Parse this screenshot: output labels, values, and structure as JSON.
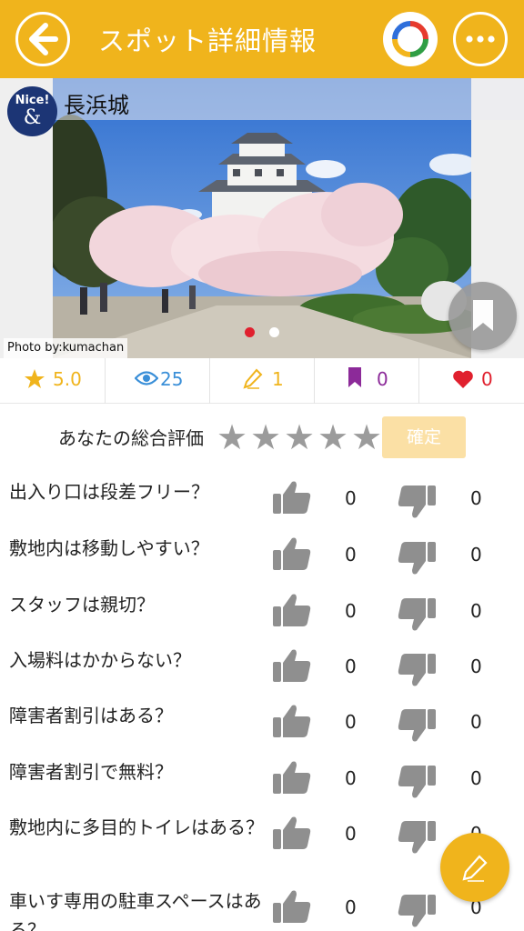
{
  "header": {
    "title": "スポット詳細情報",
    "back_icon": "arrow-left-icon",
    "ring_icon": "multicolor-ring-icon",
    "more_icon": "ellipsis-icon",
    "color": "#f0b41c"
  },
  "spot": {
    "name": "長浜城",
    "badge_text": "Nice!",
    "badge_symbol": "&",
    "photo_credit": "Photo by:kumachan",
    "carousel_active_index": 0,
    "carousel_count": 2
  },
  "stats": {
    "rating": "5.0",
    "views": "25",
    "reviews": "1",
    "bookmarks": "0",
    "likes": "0"
  },
  "rating": {
    "label": "あなたの総合評価",
    "stars_selected": 0,
    "stars_total": 5,
    "confirm_label": "確定"
  },
  "questions": [
    {
      "text": "出入り口は段差フリー？",
      "yes": "0",
      "no": "0"
    },
    {
      "text": "敷地内は移動しやすい？",
      "yes": "0",
      "no": "0"
    },
    {
      "text": "スタッフは親切？",
      "yes": "0",
      "no": "0"
    },
    {
      "text": "入場料はかからない？",
      "yes": "0",
      "no": "0"
    },
    {
      "text": "障害者割引はある？",
      "yes": "0",
      "no": "0"
    },
    {
      "text": "障害者割引で無料？",
      "yes": "0",
      "no": "0"
    },
    {
      "text": "敷地内に多目的トイレはある？",
      "yes": "0",
      "no": "0"
    },
    {
      "text": "車いす専用の駐車スペースはある？",
      "yes": "0",
      "no": "0"
    }
  ],
  "colors": {
    "star": "#f0b41c",
    "views": "#3a8fd8",
    "reviews": "#f0b41c",
    "bookmark": "#8c2a99",
    "heart": "#e0202e"
  }
}
